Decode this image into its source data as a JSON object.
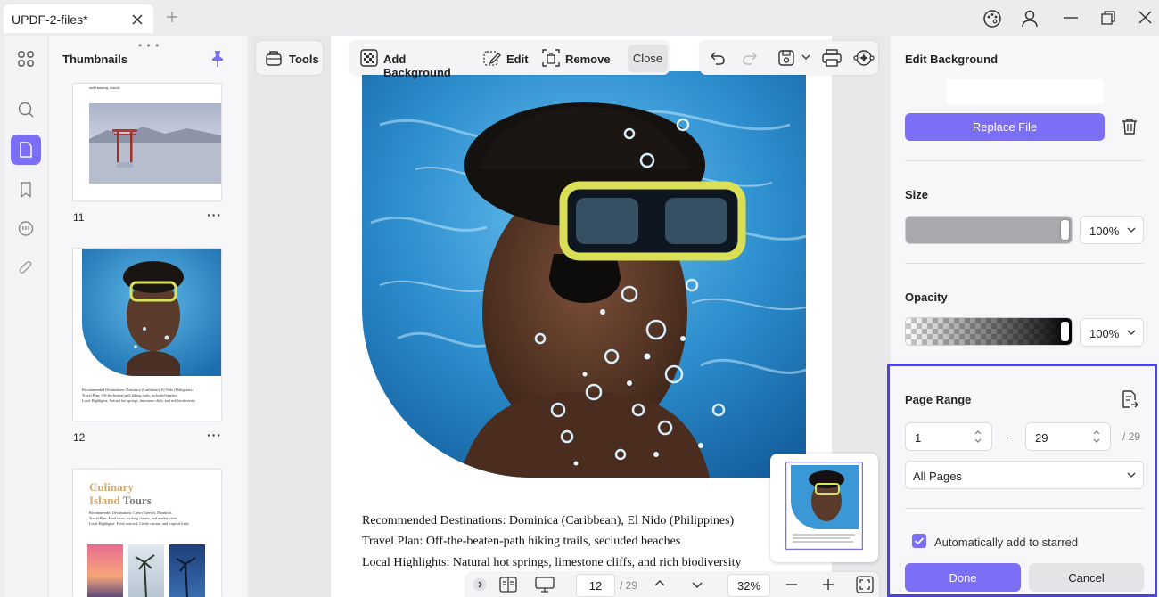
{
  "app": {
    "tab_title": "UPDF-2-files*"
  },
  "thumbnails": {
    "title": "Thumbnails",
    "pages": [
      {
        "number": "11",
        "top_text": "and stunning islands."
      },
      {
        "number": "12",
        "lines": [
          "Recommended Destinations: Dominica (Caribbean), El Nido (Philippines)",
          "Travel Plan: Off-the-beaten-path hiking trails, secluded beaches",
          "Local Highlights: Natural hot springs, limestone cliffs, and rich biodiversity"
        ]
      },
      {
        "heading_1": "Culinary",
        "heading_2a": "Island",
        "heading_2b": "Tours",
        "lines": [
          "Recommended Destinations: Crete (Greece), Mauritius",
          "Travel Plan: Food tours, cooking classes, and market visits",
          "Local Highlights: Fresh seafood, Creole cuisine, and tropical fruits"
        ]
      }
    ]
  },
  "toolbar": {
    "tools_label": "Tools",
    "add_background_label": "Add Background",
    "edit_label": "Edit",
    "remove_label": "Remove",
    "close_label": "Close"
  },
  "document": {
    "lines": [
      "Recommended Destinations: Dominica (Caribbean), El Nido (Philippines)",
      "Travel Plan: Off-the-beaten-path hiking trails, secluded beaches",
      "Local Highlights: Natural hot springs, limestone cliffs, and rich biodiversity"
    ]
  },
  "bottom_bar": {
    "current_page": "12",
    "total_pages": "/ 29",
    "zoom": "32%"
  },
  "panel": {
    "title": "Edit Background",
    "replace_file_label": "Replace File",
    "size_label": "Size",
    "size_value": "100%",
    "opacity_label": "Opacity",
    "opacity_value": "100%",
    "page_range_label": "Page Range",
    "range_from": "1",
    "range_dash": "-",
    "range_to": "29",
    "range_total": "/ 29",
    "pages_select": "All Pages",
    "auto_star_label": "Automatically add to starred",
    "done_label": "Done",
    "cancel_label": "Cancel"
  },
  "colors": {
    "accent": "#7b6ff5",
    "highlight_border": "#4b45d9"
  }
}
